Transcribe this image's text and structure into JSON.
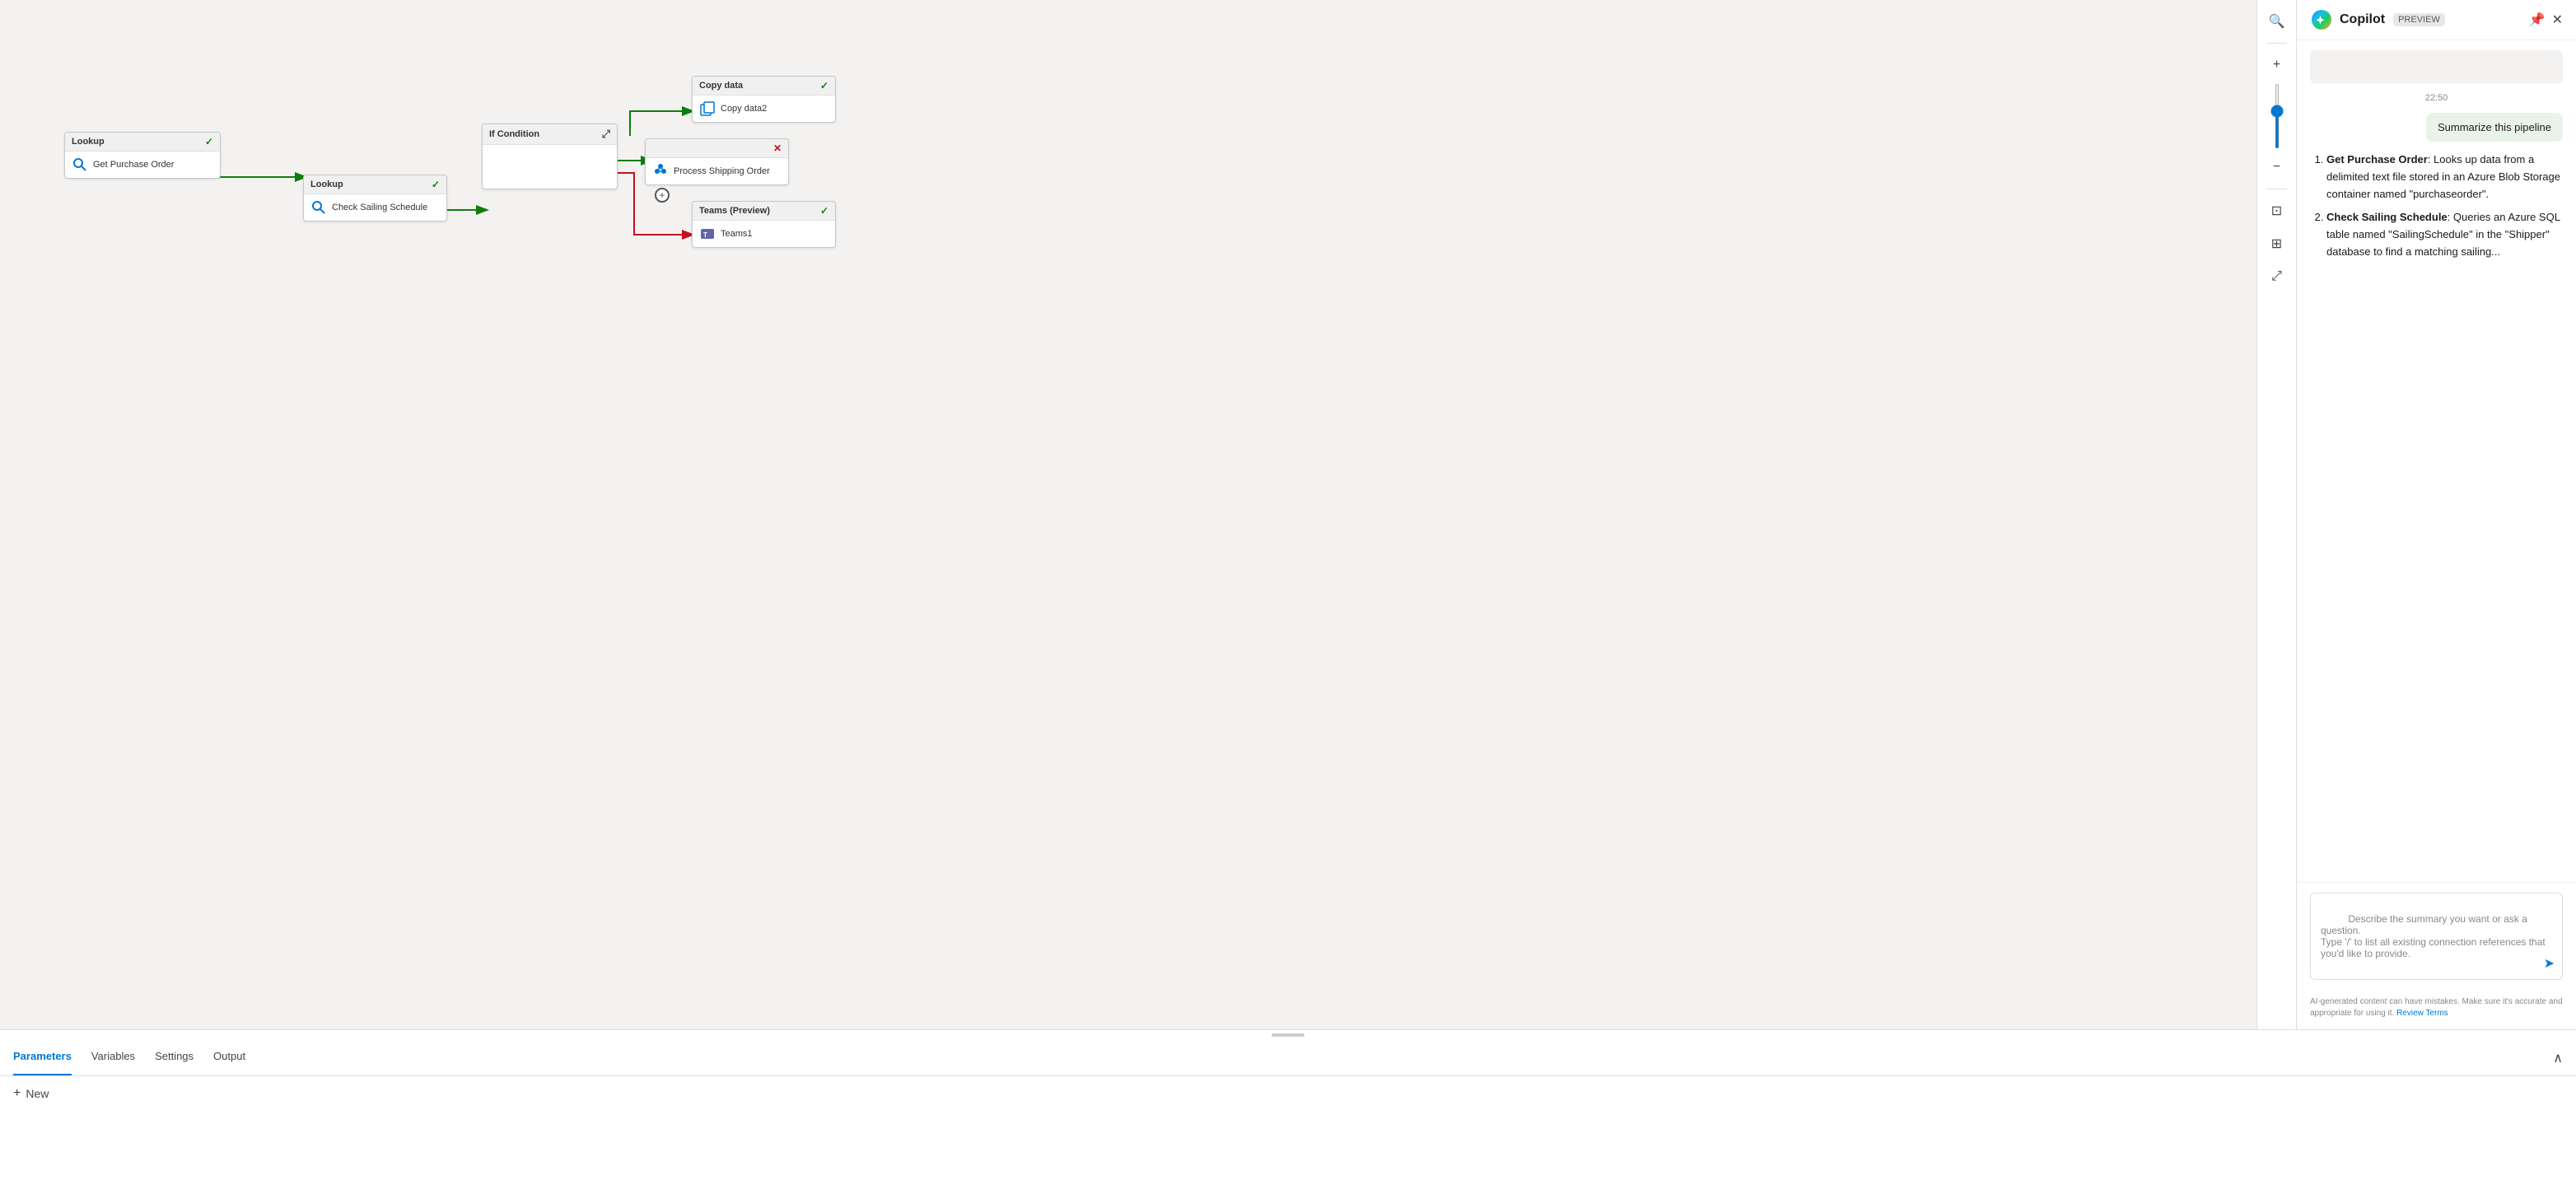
{
  "canvas": {
    "nodes": {
      "lookup1": {
        "header": "Lookup",
        "body": "Get Purchase Order",
        "type": "lookup"
      },
      "lookup2": {
        "header": "Lookup",
        "body": "Check Sailing Schedule",
        "type": "lookup"
      },
      "ifcondition": {
        "header": "If Condition",
        "type": "condition"
      },
      "processShipping": {
        "header": "",
        "body": "Process Shipping Order",
        "type": "activity"
      },
      "copyData": {
        "header": "Copy data",
        "body": "Copy data2",
        "type": "copy"
      },
      "teamsPreview": {
        "header": "Teams (Preview)",
        "body": "Teams1",
        "type": "teams"
      }
    }
  },
  "bottomPanel": {
    "tabs": [
      {
        "label": "Parameters",
        "active": true
      },
      {
        "label": "Variables",
        "active": false
      },
      {
        "label": "Settings",
        "active": false
      },
      {
        "label": "Output",
        "active": false
      }
    ],
    "newButton": "New"
  },
  "copilot": {
    "title": "Copilot",
    "previewLabel": "PREVIEW",
    "timestamp": "22:50",
    "userMessage": "Summarize this pipeline",
    "assistantMessage": {
      "intro": "",
      "items": [
        {
          "title": "Get Purchase Order",
          "titleSuffix": ": Looks up data from a delimited text file stored in an Azure Blob Storage container named \"purchaseorder\"."
        },
        {
          "title": "Check Sailing Schedule",
          "titleSuffix": ": Queries an Azure SQL table named \"SailingSchedule\" in the \"Shipper\" database to find a matching sailing..."
        }
      ]
    },
    "inputPlaceholder": "Describe the summary you want or ask a question.\nType '/' to list all existing connection references that you'd like to provide.",
    "footerText": "AI-generated content can have mistakes. Make sure it's accurate and appropriate for using it. ",
    "footerLink": "Review Terms"
  },
  "toolbar": {
    "searchIcon": "🔍",
    "zoomInIcon": "+",
    "zoomOutIcon": "−",
    "fitIcon": "⊡",
    "gridIcon": "⊞",
    "expandIcon": "⤢"
  }
}
